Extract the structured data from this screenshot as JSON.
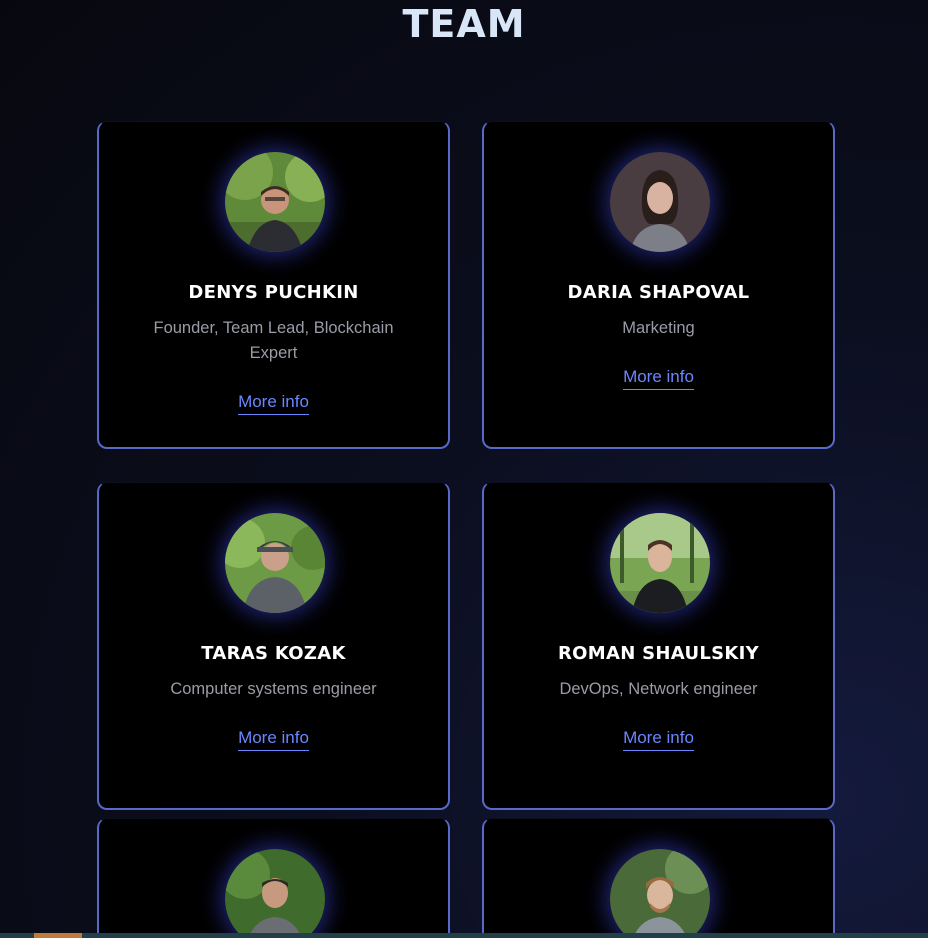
{
  "page": {
    "title": "TEAM"
  },
  "members": [
    {
      "name": "DENYS PUCHKIN",
      "role": "Founder, Team Lead, Blockchain Expert",
      "link": "More info"
    },
    {
      "name": "DARIA SHAPOVAL",
      "role": "Marketing",
      "link": "More info"
    },
    {
      "name": "TARAS KOZAK",
      "role": "Computer systems engineer",
      "link": "More info"
    },
    {
      "name": "ROMAN SHAULSKIY",
      "role": "DevOps, Network engineer",
      "link": "More info"
    }
  ],
  "colors": {
    "accent": "#6b86ff",
    "border": "#5869c9",
    "title": "#d8e6f7"
  }
}
